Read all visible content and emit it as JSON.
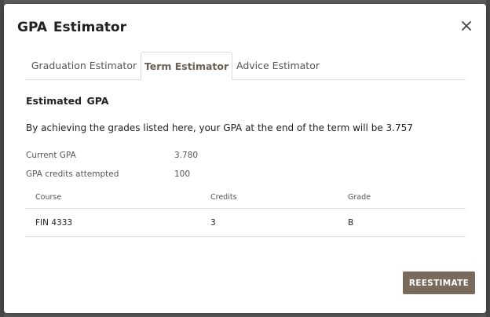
{
  "modal": {
    "title": "GPA Estimator",
    "close_label": "×"
  },
  "tabs": [
    {
      "label": "Graduation Estimator",
      "active": false
    },
    {
      "label": "Term Estimator",
      "active": true
    },
    {
      "label": "Advice Estimator",
      "active": false
    }
  ],
  "estimate": {
    "section_title": "Estimated GPA",
    "summary": "By achieving the grades listed here, your GPA at the end of the term will be 3.757",
    "stats": [
      {
        "label": "Current GPA",
        "value": "3.780"
      },
      {
        "label": "GPA credits attempted",
        "value": "100"
      }
    ]
  },
  "table": {
    "headers": [
      "Course",
      "Credits",
      "Grade"
    ],
    "rows": [
      [
        "FIN 4333",
        "3",
        "B"
      ]
    ]
  },
  "actions": {
    "reestimate_label": "REESTIMATE"
  },
  "colors": {
    "accent": "#7a6a5c",
    "active_tab_text": "#6b5e52"
  },
  "icons": {
    "close": "close-icon"
  }
}
